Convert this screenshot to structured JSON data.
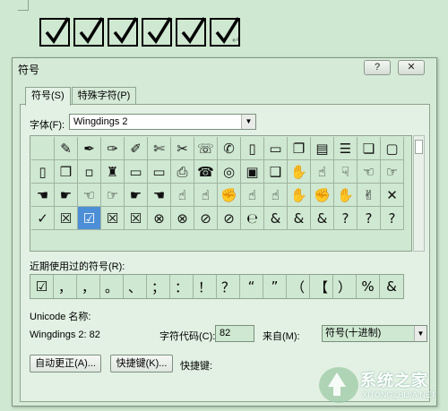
{
  "document": {
    "checkbox_count": 6,
    "paragraph_mark": "↵"
  },
  "dialog": {
    "title": "符号",
    "help_button": "?",
    "close_button": "✕",
    "tabs": [
      {
        "label": "符号(S)",
        "active": true
      },
      {
        "label": "特殊字符(P)",
        "active": false
      }
    ],
    "font_label": "字体(F):",
    "font_value": "Wingdings 2",
    "symbols": [
      [
        "",
        "✎",
        "✒",
        "✑",
        "✐",
        "✄",
        "✂",
        "☏",
        "✆",
        "▯",
        "▭",
        "❐",
        "▤",
        "☰",
        "❏",
        "▢"
      ],
      [
        "▯",
        "❒",
        "▫",
        "♜",
        "▭",
        "▭",
        "⎙",
        "☎",
        "◎",
        "▣",
        "❑",
        "✋",
        "☝",
        "☟",
        "☜",
        "☞"
      ],
      [
        "☚",
        "☛",
        "☜",
        "☞",
        "☛",
        "☚",
        "☝",
        "☝",
        "✊",
        "☝",
        "☝",
        "✋",
        "✊",
        "✋",
        "✌",
        "✕"
      ],
      [
        "✓",
        "☒",
        "☑",
        "☒",
        "☒",
        "⊗",
        "⊗",
        "⊘",
        "⊘",
        "℮",
        "&",
        "&",
        "&",
        "?",
        "?",
        "?"
      ]
    ],
    "selected_symbol": {
      "row": 3,
      "col": 2
    },
    "recent_label": "近期使用过的符号(R):",
    "recent_symbols": [
      "☑",
      "，",
      "，",
      "。",
      "、",
      "；",
      "：",
      "！",
      "？",
      "“",
      "”",
      "（",
      "【",
      "）",
      "%",
      "&"
    ],
    "unicode_name_label": "Unicode 名称:",
    "unicode_name_value": "Wingdings 2: 82",
    "char_code_label": "字符代码(C):",
    "char_code_value": "82",
    "from_label": "来自(M):",
    "from_value": "符号(十进制)",
    "autocorrect_button": "自动更正(A)...",
    "shortcut_key_button": "快捷键(K)...",
    "shortcut_label": "快捷键:"
  },
  "watermark": {
    "text": "系统之家",
    "url": "XITONGZHIJIA.NET"
  },
  "colors": {
    "background": "#cfe8d1",
    "selection": "#4d8fd6"
  }
}
